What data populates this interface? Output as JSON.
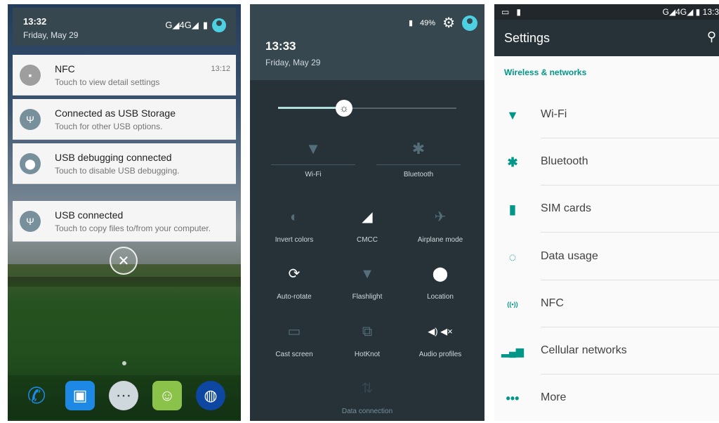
{
  "shade": {
    "time": "13:32",
    "date": "Friday, May 29",
    "network": "G◢4G◢",
    "notifications": [
      {
        "title": "NFC",
        "subtitle": "Touch to view detail settings",
        "time": "13:12",
        "icon": "nfc-sim-icon"
      },
      {
        "title": "Connected as USB Storage",
        "subtitle": "Touch for other USB options.",
        "time": "",
        "icon": "usb-icon"
      },
      {
        "title": "USB debugging connected",
        "subtitle": "Touch to disable USB debugging.",
        "time": "",
        "icon": "android-debug-icon"
      },
      {
        "title": "USB connected",
        "subtitle": "Touch to copy files to/from your computer.",
        "time": "",
        "icon": "usb-icon"
      }
    ]
  },
  "quick_settings": {
    "time": "13:33",
    "date": "Friday, May 29",
    "battery": "49%",
    "brightness_fraction": 0.37,
    "big_tiles": [
      {
        "label": "Wi-Fi",
        "icon": "wifi-off-icon"
      },
      {
        "label": "Bluetooth",
        "icon": "bluetooth-off-icon"
      }
    ],
    "tiles": [
      {
        "label": "Invert colors",
        "icon": "invert-colors-icon",
        "active": false
      },
      {
        "label": "CMCC",
        "icon": "cellular-signal-icon",
        "active": true
      },
      {
        "label": "Airplane mode",
        "icon": "airplane-icon",
        "active": false
      },
      {
        "label": "Auto-rotate",
        "icon": "auto-rotate-icon",
        "active": true
      },
      {
        "label": "Flashlight",
        "icon": "flashlight-icon",
        "active": false
      },
      {
        "label": "Location",
        "icon": "location-pin-icon",
        "active": true
      },
      {
        "label": "Cast screen",
        "icon": "cast-icon",
        "active": false
      },
      {
        "label": "HotKnot",
        "icon": "hotknot-icon",
        "active": false
      },
      {
        "label": "Audio profiles",
        "icon": "audio-profiles-icon",
        "active": true
      },
      {
        "label": "Data connection",
        "icon": "data-connection-icon",
        "active": false
      }
    ]
  },
  "settings": {
    "status_time": "13:3",
    "status_network": "G◢4G◢ ▮",
    "title": "Settings",
    "section": "Wireless & networks",
    "accent": "#009688",
    "items": [
      {
        "label": "Wi-Fi",
        "icon": "wifi-icon"
      },
      {
        "label": "Bluetooth",
        "icon": "bluetooth-icon"
      },
      {
        "label": "SIM cards",
        "icon": "sim-card-icon"
      },
      {
        "label": "Data usage",
        "icon": "data-usage-icon"
      },
      {
        "label": "NFC",
        "icon": "nfc-icon"
      },
      {
        "label": "Cellular networks",
        "icon": "cellular-bars-icon"
      },
      {
        "label": "More",
        "icon": "more-dots-icon"
      }
    ]
  }
}
